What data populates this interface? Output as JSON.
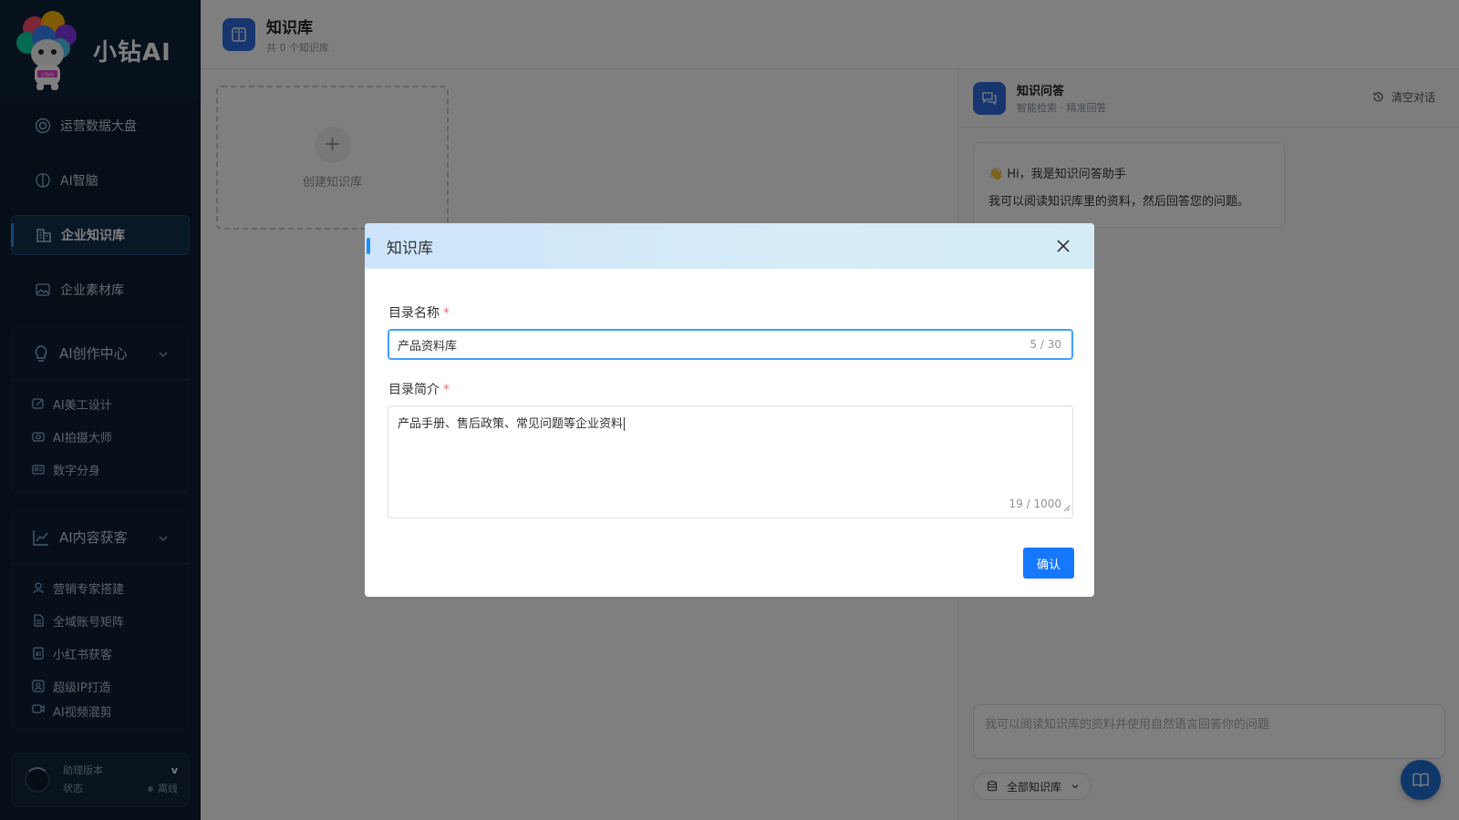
{
  "sidebar": {
    "brand": "小钻AI",
    "mascot_badge": "小钻AI",
    "nav": [
      {
        "label": "运营数据大盘",
        "icon": "dashboard-icon"
      },
      {
        "label": "AI智脑",
        "icon": "brain-icon"
      },
      {
        "label": "企业知识库",
        "icon": "building-icon",
        "active": true
      },
      {
        "label": "企业素材库",
        "icon": "image-icon"
      }
    ],
    "groups": [
      {
        "title": "AI创作中心",
        "icon": "lightbulb-icon",
        "items": [
          {
            "label": "AI美工设计",
            "icon": "edit-image-icon"
          },
          {
            "label": "AI拍摄大师",
            "icon": "camera-icon"
          },
          {
            "label": "数字分身",
            "icon": "id-card-icon"
          }
        ]
      },
      {
        "title": "AI内容获客",
        "icon": "trend-icon",
        "items": [
          {
            "label": "营销专家搭建",
            "icon": "user-icon"
          },
          {
            "label": "全域账号矩阵",
            "icon": "document-icon"
          },
          {
            "label": "小红书获客",
            "icon": "ai-doc-icon"
          },
          {
            "label": "超级IP打造",
            "icon": "profile-icon"
          },
          {
            "label": "AI视频混剪",
            "icon": "video-icon"
          }
        ]
      }
    ],
    "footer": {
      "version_label": "助理版本",
      "version_value": "v",
      "status_label": "状态",
      "status_value": "离线"
    }
  },
  "header": {
    "title": "知识库",
    "subtitle": "共 0 个知识库"
  },
  "create_card": {
    "label": "创建知识库"
  },
  "qa": {
    "title": "知识问答",
    "subtitle": "智能检索 · 精准回答",
    "clear_label": "清空对话",
    "greeting": "👋 Hi，我是知识问答助手",
    "greeting_body": "我可以阅读知识库里的资料，然后回答您的问题。",
    "input_placeholder": "我可以阅读知识库的资料并使用自然语言回答你的问题",
    "kb_select": "全部知识库"
  },
  "dialog": {
    "title": "知识库",
    "name_label": "目录名称",
    "name_value": "产品资料库",
    "name_count": "5 / 30",
    "desc_label": "目录简介",
    "desc_value": "产品手册、售后政策、常见问题等企业资料",
    "desc_count": "19 / 1000",
    "confirm_label": "确认"
  },
  "colors": {
    "primary": "#1677ff",
    "sidebar_bg": "#0d1c2e",
    "required": "#f56c6c"
  }
}
